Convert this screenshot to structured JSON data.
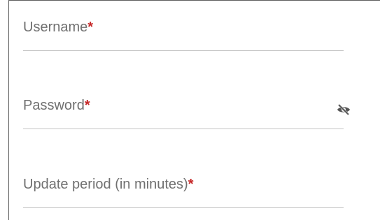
{
  "form": {
    "username": {
      "label": "Username",
      "required_mark": "*",
      "value": ""
    },
    "password": {
      "label": "Password",
      "required_mark": "*",
      "value": "",
      "toggle_icon": "visibility-off-icon"
    },
    "update_period": {
      "label": "Update period (in minutes)",
      "required_mark": "*",
      "value": ""
    }
  },
  "colors": {
    "label": "#707070",
    "required": "#c62828",
    "underline": "#c4c4c4",
    "icon": "#555555"
  }
}
